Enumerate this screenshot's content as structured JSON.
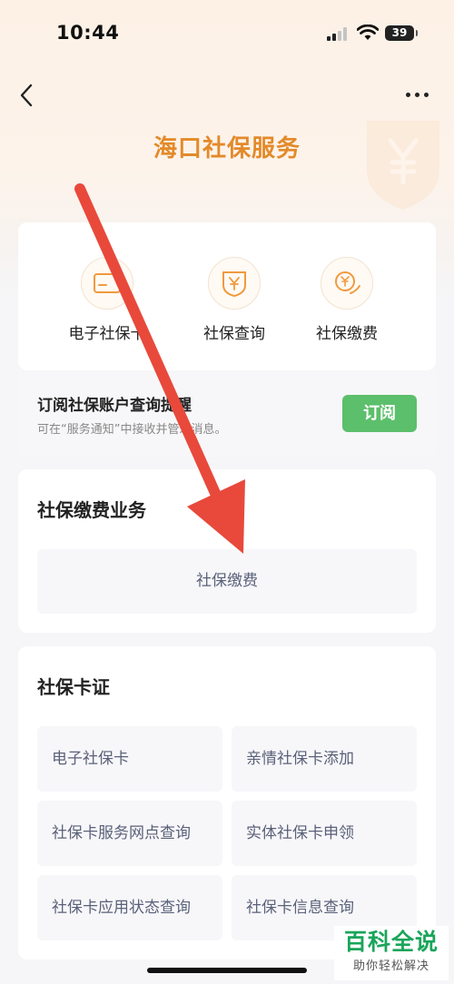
{
  "status_bar": {
    "time": "10:44",
    "battery": "39"
  },
  "header": {
    "title": "海口社保服务"
  },
  "services": [
    {
      "label": "电子社保卡",
      "icon": "card-icon"
    },
    {
      "label": "社保查询",
      "icon": "yuan-shield-icon"
    },
    {
      "label": "社保缴费",
      "icon": "yuan-hand-icon"
    }
  ],
  "subscribe": {
    "title": "订阅社保账户查询提醒",
    "desc": "可在“服务通知”中接收并管理消息。",
    "button": "订阅"
  },
  "pay_section": {
    "title": "社保缴费业务",
    "items": [
      "社保缴费"
    ]
  },
  "card_section": {
    "title": "社保卡证",
    "items": [
      "电子社保卡",
      "亲情社保卡添加",
      "社保卡服务网点查询",
      "实体社保卡申领",
      "社保卡应用状态查询",
      "社保卡信息查询"
    ]
  },
  "brand": {
    "name": "百科全说",
    "sub": "助你轻松解决"
  },
  "colors": {
    "accent": "#e38a2a",
    "button_green": "#5cbf6b",
    "arrow_red": "#e8493b",
    "brand_green": "#1aa55a"
  }
}
